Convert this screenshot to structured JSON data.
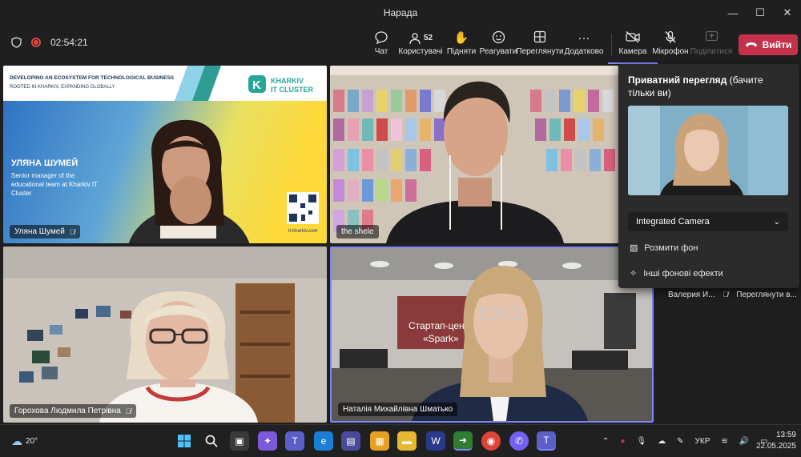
{
  "window": {
    "title": "Нарада",
    "minimize": "—",
    "maximize": "☐",
    "close": "✕"
  },
  "meeting": {
    "timer": "02:54:21"
  },
  "toolbar": {
    "chat": "Чат",
    "people": "Користувачі",
    "people_count": "52",
    "raise": "Підняти",
    "react": "Реагувати",
    "view": "Переглянути",
    "more": "Додатково",
    "camera": "Камера",
    "mic": "Мікрофон",
    "share": "Поділитися",
    "leave": "Вийти"
  },
  "tiles": [
    {
      "name": "Уляна Шумей"
    },
    {
      "name": "the shele"
    },
    {
      "name": "Горохова Людмила Петрівна"
    },
    {
      "name": "Наталія Михайлівна Шматько"
    }
  ],
  "slide": {
    "header_line1": "DEVELOPING AN ECOSYSTEM FOR TECHNOLOGICAL BUSINESS",
    "header_line2": "ROOTED IN KHARKIV, EXPANDING GLOBALLY",
    "logo_line1": "KHARKIV",
    "logo_line2": "IT CLUSTER",
    "speaker_name": "УЛЯНА ШУМЕЙ",
    "speaker_role": "Senior manager of the educational team at Kharkiv IT Cluster",
    "site": "it-kharkiv.com"
  },
  "room_sign": {
    "line1": "Стартап-цен",
    "line2": "«Spark»"
  },
  "camera_panel": {
    "title_bold": "Приватний перегляд",
    "title_rest": " (бачите тільки ви)",
    "device": "Integrated Camera",
    "blur": "Розмити фон",
    "effects": "Інші фонові ефекти"
  },
  "side_participants": {
    "name": "Валерия И...",
    "action": "Переглянути в..."
  },
  "taskbar": {
    "weather": "20°",
    "lang": "УКР",
    "time": "13:59",
    "date": "22.05.2025"
  },
  "colors": {
    "leave": "#c4314b",
    "accent": "#7f85f5",
    "record": "#e0473f",
    "slide_blue": "#1f6fb8",
    "slide_yellow": "#ffd83a"
  }
}
